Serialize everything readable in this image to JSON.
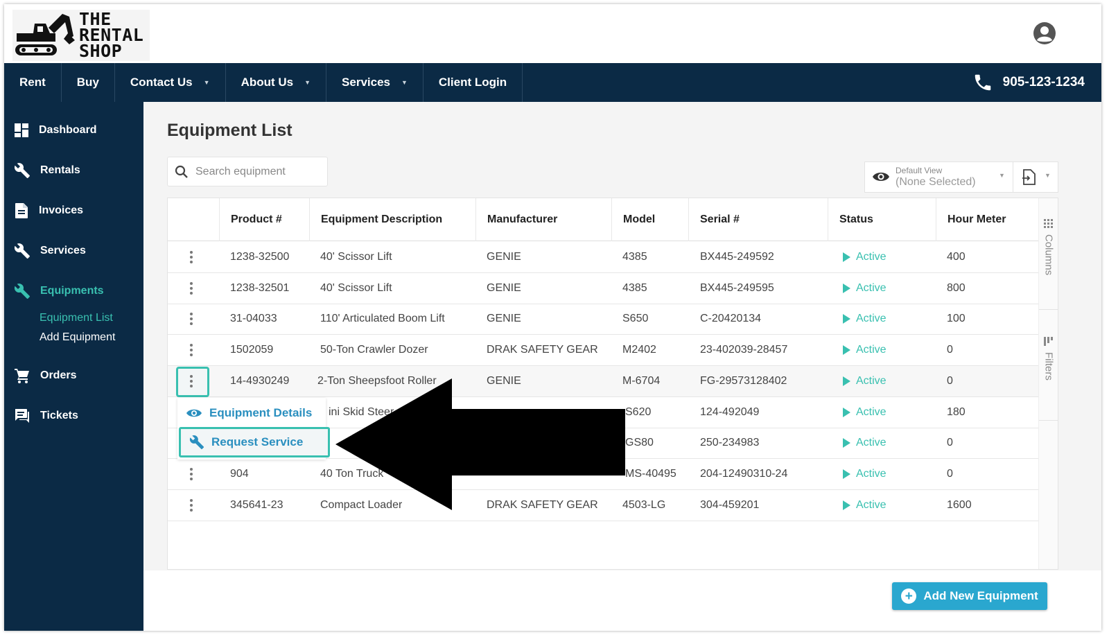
{
  "brand": {
    "logo_text_line1": "THE",
    "logo_text_line2": "RENTAL",
    "logo_text_line3": "SHOP"
  },
  "nav": {
    "items": [
      {
        "label": "Rent",
        "has_dropdown": false
      },
      {
        "label": "Buy",
        "has_dropdown": false
      },
      {
        "label": "Contact Us",
        "has_dropdown": true
      },
      {
        "label": "About Us",
        "has_dropdown": true
      },
      {
        "label": "Services",
        "has_dropdown": true
      },
      {
        "label": "Client Login",
        "has_dropdown": false
      }
    ],
    "phone": "905-123-1234"
  },
  "sidebar": {
    "items": [
      {
        "label": "Dashboard",
        "icon": "dashboard-icon"
      },
      {
        "label": "Rentals",
        "icon": "wrench-icon"
      },
      {
        "label": "Invoices",
        "icon": "document-icon"
      },
      {
        "label": "Services",
        "icon": "wrench-icon"
      },
      {
        "label": "Equipments",
        "icon": "wrench-icon",
        "active": true
      },
      {
        "label": "Orders",
        "icon": "cart-icon"
      },
      {
        "label": "Tickets",
        "icon": "chat-icon"
      }
    ],
    "sub_items": [
      {
        "label": "Equipment List",
        "active": true
      },
      {
        "label": "Add Equipment",
        "active": false
      }
    ]
  },
  "main": {
    "title": "Equipment List",
    "search": {
      "placeholder": "Search equipment",
      "value": ""
    },
    "view": {
      "label": "Default View",
      "value": "(None Selected)"
    },
    "side_tabs": {
      "columns": "Columns",
      "filters": "Filters"
    },
    "add_button": "Add New Equipment"
  },
  "table": {
    "columns": [
      "Product #",
      "Equipment Description",
      "Manufacturer",
      "Model",
      "Serial #",
      "Status",
      "Hour Meter"
    ],
    "rows": [
      {
        "product": "1238-32500",
        "description": "40' Scissor Lift",
        "manufacturer": "GENIE",
        "model": "4385",
        "serial": "BX445-249592",
        "status": "Active",
        "hours": "400"
      },
      {
        "product": "1238-32501",
        "description": "40' Scissor Lift",
        "manufacturer": "GENIE",
        "model": "4385",
        "serial": "BX445-249595",
        "status": "Active",
        "hours": "800"
      },
      {
        "product": "31-04033",
        "description": "110' Articulated Boom Lift",
        "manufacturer": "GENIE",
        "model": "S650",
        "serial": "C-20420134",
        "status": "Active",
        "hours": "100"
      },
      {
        "product": "1502059",
        "description": "50-Ton Crawler Dozer",
        "manufacturer": "DRAK SAFETY GEAR",
        "model": "M2402",
        "serial": "23-402039-28457",
        "status": "Active",
        "hours": "0"
      },
      {
        "product": "14-4930249",
        "description": "2-Ton Sheepsfoot Roller",
        "manufacturer": "GENIE",
        "model": "M-6704",
        "serial": "FG-29573128402",
        "status": "Active",
        "hours": "0"
      },
      {
        "product": "",
        "description": "ini Skid Steer",
        "manufacturer": "",
        "model": "S620",
        "serial": "124-492049",
        "status": "Active",
        "hours": "180"
      },
      {
        "product": "",
        "description": "",
        "manufacturer": "",
        "model": "GS80",
        "serial": "250-234983",
        "status": "Active",
        "hours": "0"
      },
      {
        "product": "904",
        "description": "40 Ton Truck",
        "manufacturer": "",
        "model": "MS-40495",
        "serial": "204-12490310-24",
        "status": "Active",
        "hours": "0"
      },
      {
        "product": "345641-23",
        "description": "Compact Loader",
        "manufacturer": "DRAK SAFETY GEAR",
        "model": "4503-LG",
        "serial": "304-459201",
        "status": "Active",
        "hours": "1600"
      }
    ]
  },
  "row_menu": {
    "items": [
      {
        "label": "Equipment Details",
        "icon": "eye-icon"
      },
      {
        "label": "Request Service",
        "icon": "wrench-icon",
        "highlighted": true
      }
    ]
  },
  "colors": {
    "navy": "#0b2a45",
    "teal": "#39c0b0",
    "link_blue": "#2a8fbf",
    "button_blue": "#2aa7cf"
  }
}
